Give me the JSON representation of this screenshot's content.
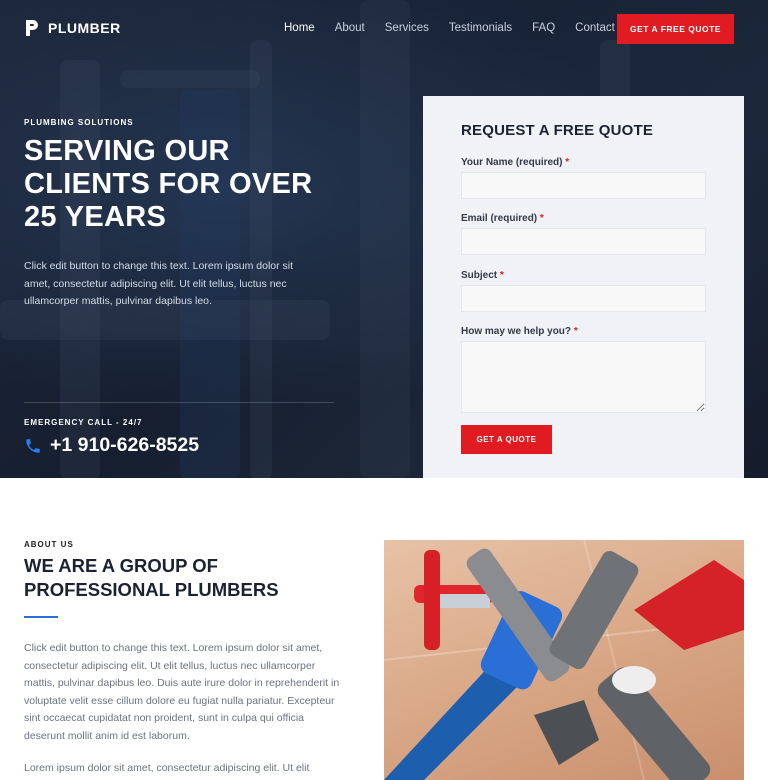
{
  "brand": {
    "name": "PLUMBER"
  },
  "nav": {
    "items": [
      "Home",
      "About",
      "Services",
      "Testimonials",
      "FAQ",
      "Contact"
    ],
    "cta": "GET A FREE QUOTE"
  },
  "hero": {
    "eyebrow": "PLUMBING SOLUTIONS",
    "title_lines": [
      "SERVING OUR",
      "CLIENTS FOR OVER",
      "25 YEARS"
    ],
    "description": "Click edit button to change this text. Lorem ipsum dolor sit amet, consectetur adipiscing elit. Ut elit tellus, luctus nec ullamcorper mattis, pulvinar dapibus leo.",
    "emergency_label": "EMERGENCY CALL - 24/7",
    "phone": "+1 910-626-8525"
  },
  "quote_form": {
    "title": "REQUEST A FREE QUOTE",
    "fields": [
      {
        "label": "Your Name (required)",
        "required_mark": "*",
        "value": ""
      },
      {
        "label": "Email (required)",
        "required_mark": "*",
        "value": ""
      },
      {
        "label": "Subject",
        "required_mark": "*",
        "value": ""
      },
      {
        "label": "How may we help you?",
        "required_mark": "*",
        "value": ""
      }
    ],
    "submit": "GET A QUOTE"
  },
  "about": {
    "eyebrow": "ABOUT US",
    "title_lines": [
      "WE ARE A GROUP OF",
      "PROFESSIONAL PLUMBERS"
    ],
    "paragraph": "Click edit button to change this text. Lorem ipsum dolor sit amet, consectetur adipiscing elit. Ut elit tellus, luctus nec ullamcorper mattis, pulvinar dapibus leo. Duis aute irure dolor in reprehenderit in voluptate velit esse cillum dolore eu fugiat nulla pariatur. Excepteur sint occaecat cupidatat non proident, sunt in culpa qui officia deserunt mollit anim id est laborum.",
    "paragraph2_partial": "Lorem ipsum dolor sit amet, consectetur adipiscing elit. Ut elit"
  },
  "colors": {
    "accent": "#e01b22",
    "link_blue": "#2a6fd6",
    "dark": "#1d2233"
  },
  "icons": {
    "logo": "plumber-logo-icon",
    "phone": "phone-icon",
    "image": "wrenches-image"
  }
}
